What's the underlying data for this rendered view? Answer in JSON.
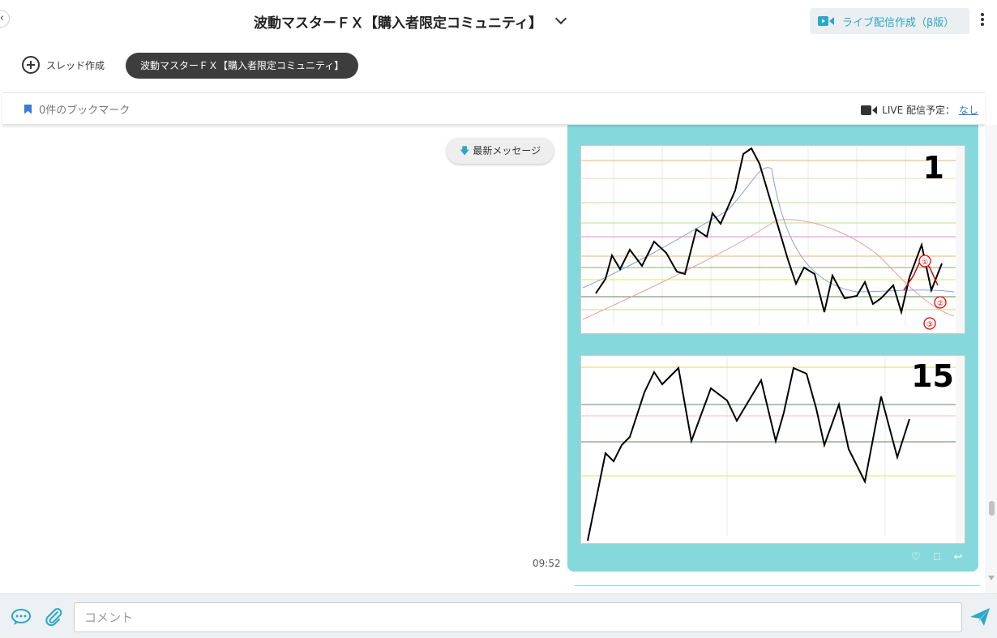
{
  "header": {
    "title": "波動マスターＦＸ【購入者限定コミュニティ】",
    "back_glyph": "‹",
    "live_create_label": "ライブ配信作成（β版）"
  },
  "threads": {
    "create_label": "スレッド作成",
    "active_thread": "波動マスターＦＸ【購入者限定コミュニティ】"
  },
  "info": {
    "bookmark_count": "0件のブックマーク",
    "live_schedule_label": "LIVE 配信予定：",
    "live_schedule_value": "なし"
  },
  "messages": {
    "latest_label": "最新メッセージ",
    "message_time": "09:52",
    "chart_labels": [
      "1",
      "15"
    ],
    "wave_labels": [
      "①",
      "②",
      "③"
    ]
  },
  "composer": {
    "placeholder": "コメント"
  },
  "colors": {
    "accent": "#29a8c7",
    "bubble": "#85d9dc",
    "pill": "#3d3d3d",
    "link": "#2a79c4"
  },
  "icons": [
    "back-arrow-icon",
    "chevron-down-icon",
    "video-camera-icon",
    "more-vertical-icon",
    "plus-circle-icon",
    "bookmark-icon",
    "arrow-down-icon",
    "heart-icon",
    "bookmark-outline-icon",
    "reply-icon",
    "chat-bubble-icon",
    "paperclip-icon",
    "send-icon"
  ]
}
